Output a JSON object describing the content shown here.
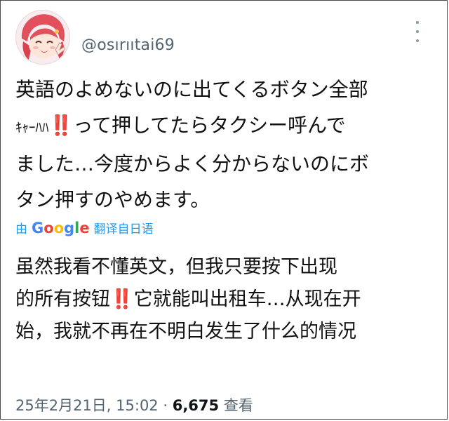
{
  "user": {
    "handle": "@osırııtai69"
  },
  "tweet": {
    "line1": "英語のよめないのに出てくるボタン全部",
    "line2_pre": "ｷｬｰﾊﾊ",
    "line2_mark": "‼️",
    "line2_post": "って押してたらタクシー呼んで",
    "line3": "ました…今度からよく分からないのにボ",
    "line4": "タン押すのやめます。"
  },
  "translate": {
    "prefix": "由",
    "brand": "Google",
    "suffix": "翻译自日语"
  },
  "translation": {
    "line1": "虽然我看不懂英文，但我只要按下出现",
    "line2_pre": "的所有按钮",
    "line2_mark": "‼️",
    "line2_post": "它就能叫出租车…从现在开",
    "line3": "始，我就不再在不明白发生了什么的情况"
  },
  "meta": {
    "date": "25年2月21日, 15:02 · ",
    "views_count": "6,675",
    "views_label": " 查看"
  },
  "colors": {
    "link": "#1d9bf0",
    "secondary_text": "#536471",
    "mark": "#d61f2c"
  },
  "icons": {
    "more": "more-vertical-icon"
  }
}
